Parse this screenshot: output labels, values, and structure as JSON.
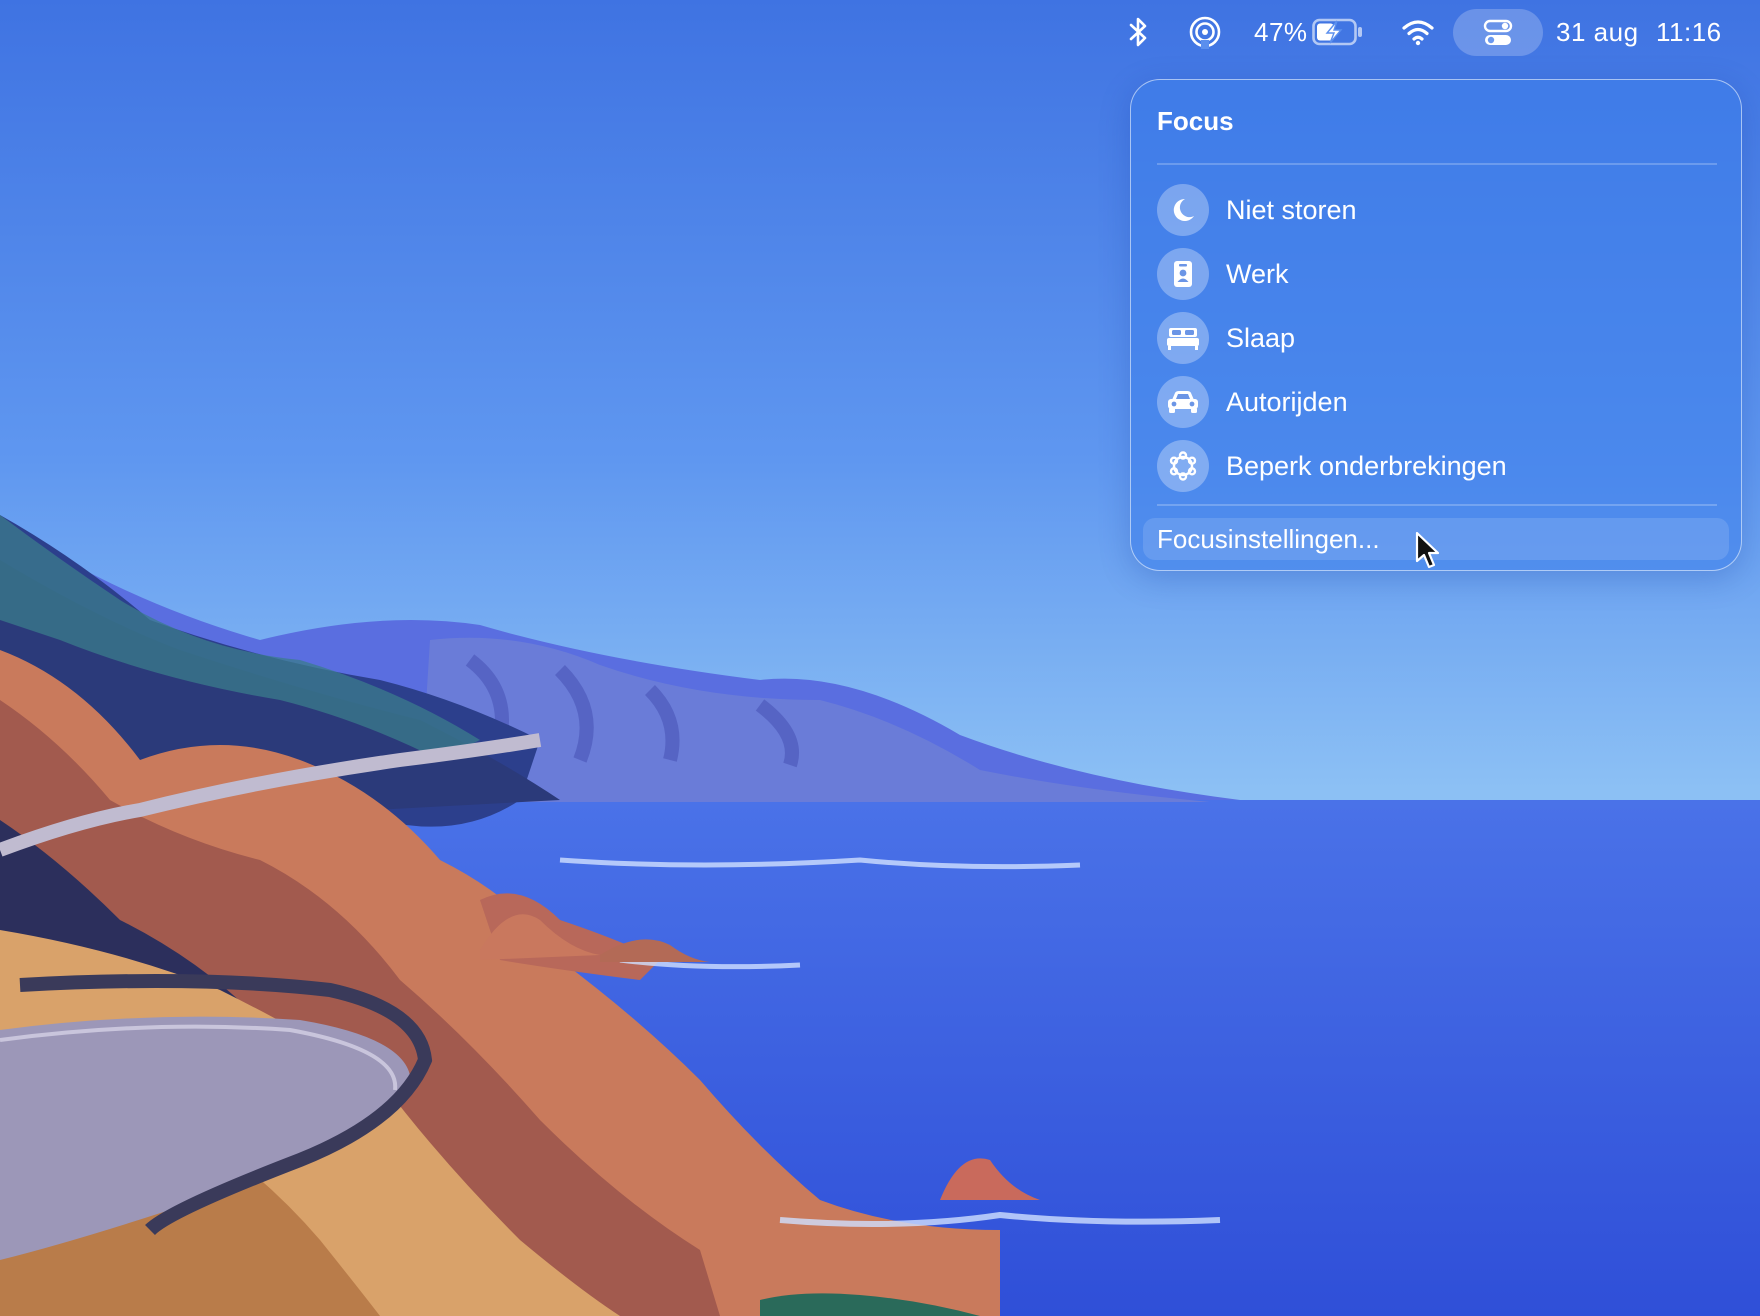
{
  "menubar": {
    "battery_percent": "47%",
    "battery_level": 0.47,
    "date": "31 aug",
    "time": "11:16",
    "icons": [
      "bluetooth-icon",
      "airdrop-icon",
      "battery-charging-icon",
      "wifi-icon",
      "control-center-icon"
    ]
  },
  "focus": {
    "title": "Focus",
    "items": [
      {
        "label": "Niet storen",
        "icon": "moon-icon"
      },
      {
        "label": "Werk",
        "icon": "badge-icon"
      },
      {
        "label": "Slaap",
        "icon": "bed-icon"
      },
      {
        "label": "Autorijden",
        "icon": "car-icon"
      },
      {
        "label": "Beperk onderbrekingen",
        "icon": "reduce-interruptions-icon"
      }
    ],
    "settings_label": "Focusinstellingen..."
  },
  "colors": {
    "sky_top": "#3f73e2",
    "sky_bottom": "#8cc0f4",
    "sea": "#3a63e2",
    "panel": "#3c7deb"
  }
}
